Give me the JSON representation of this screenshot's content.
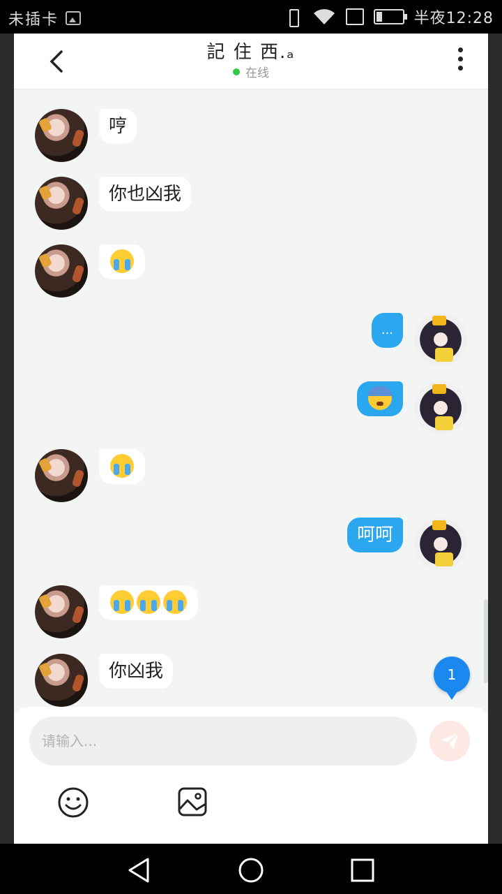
{
  "status_bar": {
    "carrier": "未插卡",
    "time": "半夜12:28",
    "icons": [
      "gallery-icon",
      "vibrate-icon",
      "wifi-icon",
      "sim-icon",
      "battery-icon"
    ]
  },
  "header": {
    "title": "記 住 西.ₐ",
    "presence": "在线",
    "icons": [
      "back-icon",
      "more-icon"
    ]
  },
  "messages": [
    {
      "side": "in",
      "text": "哼"
    },
    {
      "side": "in",
      "text": "你也凶我"
    },
    {
      "side": "in",
      "emoji": [
        "loudly-crying-face"
      ]
    },
    {
      "side": "out",
      "text": "..."
    },
    {
      "side": "out",
      "emoji": [
        "anxious-face-with-sweat"
      ]
    },
    {
      "side": "in",
      "emoji": [
        "loudly-crying-face"
      ]
    },
    {
      "side": "out",
      "text": "呵呵"
    },
    {
      "side": "in",
      "emoji": [
        "loudly-crying-face",
        "loudly-crying-face",
        "loudly-crying-face"
      ]
    },
    {
      "side": "in",
      "text": "你凶我"
    }
  ],
  "unread_badge": "1",
  "composer": {
    "placeholder": "请输入...",
    "icons": [
      "send-icon",
      "emoji-icon",
      "image-icon"
    ]
  },
  "colors": {
    "outgoing_bubble": "#2aa7ef",
    "incoming_bubble": "#ffffff",
    "chat_background": "#f3f5f4",
    "online_dot": "#2ec84b",
    "badge": "#1b88f0"
  }
}
